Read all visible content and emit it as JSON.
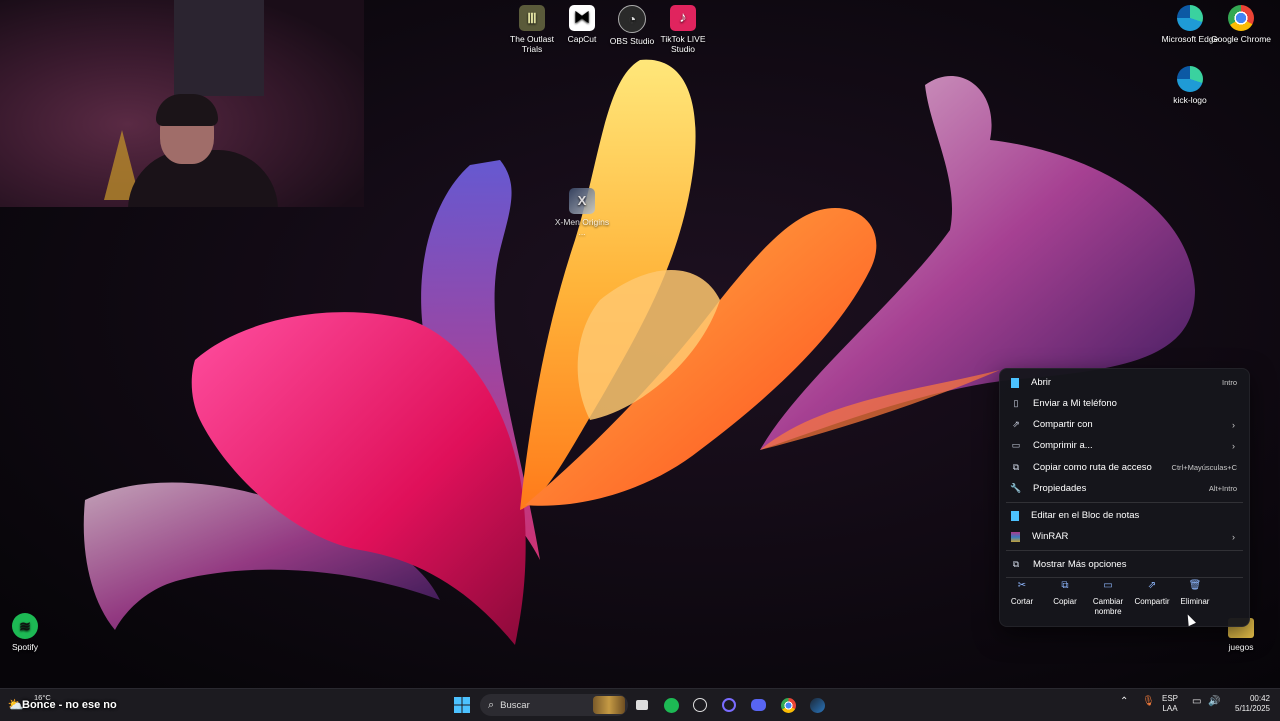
{
  "desktop": {
    "top_icons": [
      {
        "label": "The Outlast Trials",
        "icon": "outlast-icon",
        "color": "#5a5a3a"
      },
      {
        "label": "CapCut",
        "icon": "capcut-icon",
        "color": "#ffffff"
      },
      {
        "label": "OBS Studio",
        "icon": "obs-icon",
        "color": "#3a3a3a"
      },
      {
        "label": "TikTok LIVE Studio",
        "icon": "tiktok-icon",
        "color": "#e0245e"
      }
    ],
    "right_icons": [
      {
        "label": "Microsoft Edge",
        "icon": "edge-icon",
        "color": "#1f9bd6"
      },
      {
        "label": "Google Chrome",
        "icon": "chrome-icon",
        "color": "#e0453a"
      },
      {
        "label": "kick-logo",
        "icon": "kick-logo-icon",
        "color": "#1f9bd6"
      }
    ],
    "center_icon": {
      "label": "X-Men Origins ...",
      "icon": "xmen-icon"
    },
    "spotify": {
      "label": "Spotify",
      "icon": "spotify-icon",
      "color": "#1db954"
    },
    "juegos": {
      "label": "juegos",
      "icon": "folder-icon",
      "color": "#e8c14a"
    }
  },
  "context_menu": {
    "items": [
      {
        "label": "Abrir",
        "shortcut": "Intro",
        "icon": "notepad-icon"
      },
      {
        "label": "Enviar a Mi teléfono",
        "shortcut": "",
        "icon": "phone-icon"
      },
      {
        "label": "Compartir con",
        "shortcut": "",
        "icon": "share-icon",
        "submenu": true
      },
      {
        "label": "Comprimir a...",
        "shortcut": "",
        "icon": "archive-icon",
        "submenu": true
      },
      {
        "label": "Copiar como ruta de acceso",
        "shortcut": "Ctrl+Mayúsculas+C",
        "icon": "path-icon"
      },
      {
        "label": "Propiedades",
        "shortcut": "Alt+Intro",
        "icon": "wrench-icon"
      },
      {
        "label": "Editar en el Bloc de notas",
        "shortcut": "",
        "icon": "notepad-icon"
      },
      {
        "label": "WinRAR",
        "shortcut": "",
        "icon": "winrar-icon",
        "submenu": true
      },
      {
        "label": "Mostrar Más opciones",
        "shortcut": "",
        "icon": "more-options-icon"
      }
    ],
    "actions": [
      {
        "label": "Cortar",
        "icon": "scissors-icon"
      },
      {
        "label": "Copiar",
        "icon": "copy-icon"
      },
      {
        "label": "Cambiar nombre",
        "icon": "rename-icon"
      },
      {
        "label": "Compartir",
        "icon": "share-icon"
      },
      {
        "label": "Eliminar",
        "icon": "trash-icon"
      }
    ]
  },
  "taskbar": {
    "search_placeholder": "Buscar",
    "overlay_text": "Bonce - no ese no",
    "weather": "16°C",
    "lang_top": "ESP",
    "lang_bottom": "LAA",
    "time": "00:42",
    "date": "5/11/2025",
    "accent": "#4cc2ff"
  }
}
